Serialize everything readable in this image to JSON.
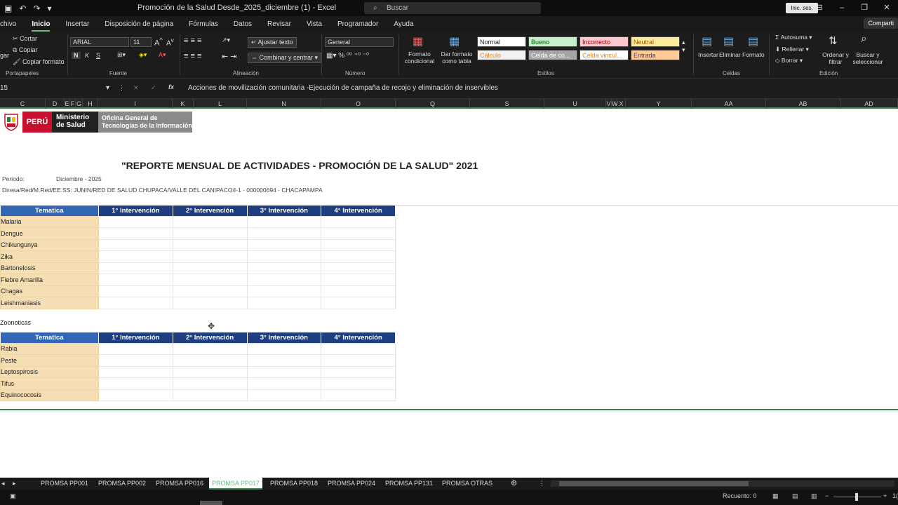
{
  "window": {
    "title": "Promoción de la Salud Desde_2025_diciembre (1)  -  Excel",
    "search_placeholder": "Buscar",
    "signin_label": "Inic. ses.",
    "share_label": "Comparti"
  },
  "menu_tabs": [
    "chivo",
    "Inicio",
    "Insertar",
    "Disposición de página",
    "Fórmulas",
    "Datos",
    "Revisar",
    "Vista",
    "Programador",
    "Ayuda"
  ],
  "ribbon": {
    "clipboard": {
      "cut": "Cortar",
      "copy": "Copiar",
      "format_painter": "Copiar formato",
      "paste": "gar",
      "group": "Portapapeles"
    },
    "font": {
      "name": "ARIAL",
      "size": "11",
      "bold": "N",
      "italic": "K",
      "underline": "S",
      "group": "Fuente"
    },
    "alignment": {
      "wrap": "Ajustar texto",
      "merge": "Combinar y centrar",
      "group": "Alineación"
    },
    "number": {
      "format": "General",
      "group": "Número"
    },
    "styles": {
      "conditional": "Formato condicional",
      "as_table": "Dar formato como tabla",
      "cells": [
        {
          "label": "Normal",
          "bg": "#ffffff",
          "fg": "#222222"
        },
        {
          "label": "Bueno",
          "bg": "#c6efce",
          "fg": "#006100"
        },
        {
          "label": "Incorrecto",
          "bg": "#ffc7ce",
          "fg": "#9c0006"
        },
        {
          "label": "Neutral",
          "bg": "#ffeb9c",
          "fg": "#9c5700"
        },
        {
          "label": "Cálculo",
          "bg": "#f2f2f2",
          "fg": "#fa7d00"
        },
        {
          "label": "Celda de co...",
          "bg": "#a5a5a5",
          "fg": "#ffffff"
        },
        {
          "label": "Celda vincul...",
          "bg": "#ffffff",
          "fg": "#fa7d00"
        },
        {
          "label": "Entrada",
          "bg": "#ffcc99",
          "fg": "#3f3f76"
        }
      ],
      "group": "Estilos"
    },
    "cells_group": {
      "insert": "Insertar",
      "delete": "Eliminar",
      "format": "Formato",
      "group": "Celdas"
    },
    "editing": {
      "autosum": "Autosuma",
      "fill": "Rellenar",
      "clear": "Borrar",
      "sort": "Ordenar y filtrar",
      "find": "Buscar y seleccionar",
      "group": "Edición"
    }
  },
  "formula_bar": {
    "name_box": "15",
    "fx": "fx",
    "content": "Acciones de movilización comunitaria -Ejecución de campaña de recojo y eliminación de inservibles"
  },
  "columns": [
    "C",
    "D",
    "E",
    "F",
    "G",
    "H",
    "I",
    "K",
    "L",
    "N",
    "O",
    "Q",
    "S",
    "U",
    "V",
    "W",
    "X",
    "Y",
    "AA",
    "AB",
    "AD"
  ],
  "header": {
    "country": "PERÚ",
    "ministry": "Ministerio de Salud",
    "office": "Oficina General de Tecnologías de la Información"
  },
  "report": {
    "title": "\"REPORTE MENSUAL DE ACTIVIDADES - PROMOCIÓN DE LA SALUD\" 2021",
    "period_label": "Periodo:",
    "period_value": "Diciembre - 2025",
    "location": "Diresa/Red/M.Red/EE.SS: JUNIN/RED DE SALUD CHUPACA/VALLE DEL CANIPACO/I-1 - 000000694 - CHACAPAMPA"
  },
  "table_headers": [
    "Tematica",
    "1° Intervención",
    "2° Intervención",
    "3° Intervención",
    "4° Intervención"
  ],
  "table1": [
    "Malaria",
    "Dengue",
    "Chikungunya",
    "Zika",
    "Bartonelosis",
    "Fiebre Amarilla",
    "Chagas",
    "Leishmaniasis"
  ],
  "section2_label": "Zoonoticas",
  "table2": [
    "Rabia",
    "Peste",
    "Leptospirosis",
    "Tifus",
    "Equinococosis"
  ],
  "sheet_tabs": [
    "PROMSA PP001",
    "PROMSA PP002",
    "PROMSA PP016",
    "PROMSA PP017",
    "PROMSA PP018",
    "PROMSA PP024",
    "PROMSA PP131",
    "PROMSA OTRAS"
  ],
  "active_sheet": "PROMSA PP017",
  "status": {
    "count": "Recuento: 0",
    "zoom": "1("
  }
}
